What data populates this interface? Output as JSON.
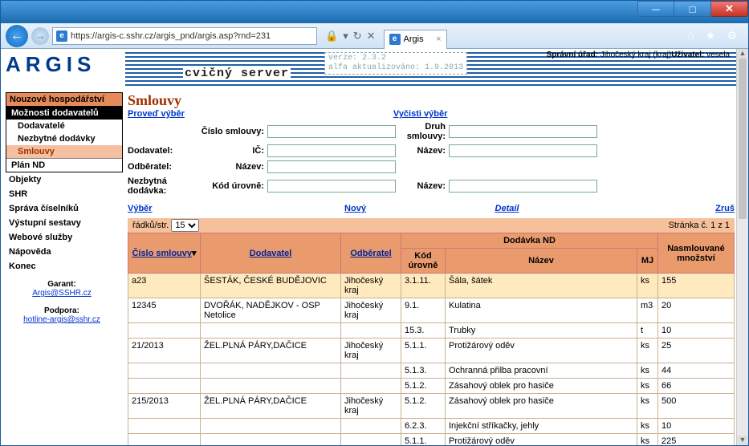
{
  "browser": {
    "url": "https://argis-c.sshr.cz/argis_pnd/argis.asp?rnd=231",
    "tab_title": "Argis"
  },
  "header": {
    "logo": "ARGIS",
    "server_label": "cvičný server",
    "verze_line1": "verze: 2.3.2",
    "verze_line2": "alfa aktualizováno: 1.9.2013",
    "spravni_label": "Správní úřad:",
    "spravni_value": "Jihočeský kraj (kraj)",
    "uzivatel_label": "Uživatel:",
    "uzivatel_value": "vesela"
  },
  "sidebar": {
    "group1_title": "Nouzové hospodářství",
    "group1_sub": "Možnosti dodavatelů",
    "group1_items": [
      "Dodavatelé",
      "Nezbytné dodávky",
      "Smlouvy"
    ],
    "plan": "Plán ND",
    "list2": [
      "Objekty",
      "SHR",
      "Správa číselníků",
      "Výstupní sestavy",
      "Webové služby",
      "Nápověda",
      "Konec"
    ],
    "garant_label": "Garant:",
    "garant_mail": "Argis@SSHR.cz",
    "podpora_label": "Podpora:",
    "podpora_mail": "hotline-argis@sshr.cz"
  },
  "page": {
    "title": "Smlouvy",
    "link_proved": "Proveď výběr",
    "link_vycisti": "Vyčisti výběr",
    "lab_cislo": "Číslo smlouvy:",
    "lab_druh": "Druh smlouvy:",
    "lab_dodavatel": "Dodavatel:",
    "lab_ic": "IČ:",
    "lab_nazev": "Název:",
    "lab_odberatel": "Odběratel:",
    "lab_nezbytna": "Nezbytná dodávka:",
    "lab_kod": "Kód úrovně:",
    "act_vyber": "Výběr",
    "act_novy": "Nový",
    "act_detail": "Detail",
    "act_zrus": "Zruš",
    "pager_radku": "řádků/str.",
    "pager_value": "15",
    "pager_stranka": "Stránka č. 1 z 1",
    "th_cislo": "Číslo smlouvy",
    "th_dodavatel": "Dodavatel",
    "th_odberatel": "Odběratel",
    "th_dodavka": "Dodávka ND",
    "th_kod": "Kód úrovně",
    "th_nazev": "Název",
    "th_mj": "MJ",
    "th_mnoz": "Nasmlouvané množství",
    "rows": [
      {
        "c": "a23",
        "dod": "ŠESTÁK, ČESKÉ BUDĚJOVIC",
        "odb": "Jihočeský kraj",
        "kod": "3.1.11.",
        "naz": "Šála, šátek",
        "mj": "ks",
        "mn": "155",
        "sel": true
      },
      {
        "c": "12345",
        "dod": "DVOŘÁK, NADĚJKOV - OSP Netolice",
        "odb": "Jihočeský kraj",
        "kod": "9.1.",
        "naz": "Kulatina",
        "mj": "m3",
        "mn": "20"
      },
      {
        "c": "",
        "dod": "",
        "odb": "",
        "kod": "15.3.",
        "naz": "Trubky",
        "mj": "t",
        "mn": "10"
      },
      {
        "c": "21/2013",
        "dod": "ŽEL.PLNÁ PÁRY,DAČICE",
        "odb": "Jihočeský kraj",
        "kod": "5.1.1.",
        "naz": "Protižárový oděv",
        "mj": "ks",
        "mn": "25"
      },
      {
        "c": "",
        "dod": "",
        "odb": "",
        "kod": "5.1.3.",
        "naz": "Ochranná přilba pracovní",
        "mj": "ks",
        "mn": "44"
      },
      {
        "c": "",
        "dod": "",
        "odb": "",
        "kod": "5.1.2.",
        "naz": "Zásahový oblek pro hasiče",
        "mj": "ks",
        "mn": "66"
      },
      {
        "c": "215/2013",
        "dod": "ŽEL.PLNÁ PÁRY,DAČICE",
        "odb": "Jihočeský kraj",
        "kod": "5.1.2.",
        "naz": "Zásahový oblek pro hasiče",
        "mj": "ks",
        "mn": "500"
      },
      {
        "c": "",
        "dod": "",
        "odb": "",
        "kod": "6.2.3.",
        "naz": "Injekční stříkačky, jehly",
        "mj": "ks",
        "mn": "10"
      },
      {
        "c": "",
        "dod": "",
        "odb": "",
        "kod": "5.1.1.",
        "naz": "Protižárový oděv",
        "mj": "ks",
        "mn": "225"
      }
    ]
  }
}
